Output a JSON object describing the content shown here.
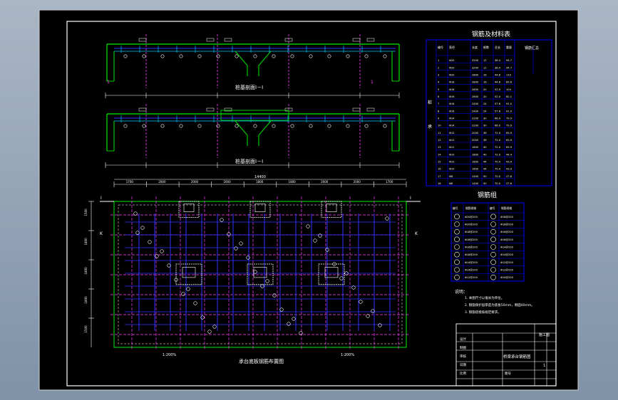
{
  "colors": {
    "background": "#000000",
    "frame": "#ffffff",
    "beam": "#00c800",
    "rebar": "#3030ff",
    "rebar_light": "#00c8ff",
    "axis": "#ff40ff",
    "dim": "#ffffff",
    "pile": "#ffffff",
    "table_line": "#0000ff",
    "note_text": "#ffffff"
  },
  "section1": {
    "title": "桩基剖面I－I",
    "label_left": "1",
    "label_right": "1"
  },
  "section2": {
    "title": "桩基剖面I－I"
  },
  "plan": {
    "title": "承台底板钢筋布置图",
    "scale_left": "1:200%",
    "scale_right": "1:200%",
    "total_dim": "14400",
    "segment_dims": [
      "1700",
      "2000",
      "2000",
      "2000",
      "1800",
      "1800",
      "2000",
      "2000",
      "1700"
    ],
    "section_mark_left": "I",
    "section_mark_right": "I",
    "side_mark_left": "K",
    "side_mark_right": "K",
    "side_dims": [
      "1500",
      "1800",
      "1800",
      "1800",
      "1500"
    ]
  },
  "rebar_table": {
    "title": "钢筋及材料表",
    "headers": [
      "编号",
      "直径",
      "长度",
      "根数",
      "总长",
      "重量"
    ],
    "group_labels": [
      "桩",
      "承"
    ],
    "extra_title": "钢筋汇总",
    "rows": [
      [
        "1",
        "Φ20",
        "3200",
        "12",
        "38.4",
        "94.7"
      ],
      [
        "2",
        "Φ20",
        "3200",
        "12",
        "38.4",
        "94.7"
      ],
      [
        "3",
        "Φ20",
        "2800",
        "16",
        "44.8",
        "110"
      ],
      [
        "4",
        "Φ18",
        "2800",
        "16",
        "44.8",
        "89.6"
      ],
      [
        "5",
        "Φ18",
        "2600",
        "20",
        "52.0",
        "104"
      ],
      [
        "6",
        "Φ16",
        "2600",
        "20",
        "52.0",
        "82.1"
      ],
      [
        "7",
        "Φ16",
        "2400",
        "24",
        "57.6",
        "91.0"
      ],
      [
        "8",
        "Φ16",
        "2400",
        "24",
        "57.6",
        "91.0"
      ],
      [
        "9",
        "Φ14",
        "2200",
        "30",
        "66.0",
        "79.9"
      ],
      [
        "10",
        "Φ14",
        "2200",
        "30",
        "66.0",
        "79.9"
      ],
      [
        "11",
        "Φ12",
        "2000",
        "36",
        "72.0",
        "63.9"
      ],
      [
        "12",
        "Φ12",
        "2000",
        "36",
        "72.0",
        "63.9"
      ],
      [
        "13",
        "Φ12",
        "1800",
        "40",
        "72.0",
        "63.9"
      ],
      [
        "14",
        "Φ10",
        "1800",
        "40",
        "72.0",
        "44.4"
      ],
      [
        "15",
        "Φ10",
        "1600",
        "44",
        "70.4",
        "43.4"
      ],
      [
        "16",
        "Φ10",
        "1600",
        "44",
        "70.4",
        "43.4"
      ],
      [
        "17",
        "Φ8",
        "1400",
        "50",
        "70.0",
        "27.6"
      ],
      [
        "18",
        "Φ8",
        "1400",
        "50",
        "70.0",
        "27.6"
      ]
    ]
  },
  "legend_table": {
    "title": "钢筋组",
    "headers": [
      "编号",
      "钢筋规格",
      "编号",
      "钢筋规格"
    ],
    "rows": [
      [
        "Φ20@200",
        "Φ18@200"
      ],
      [
        "Φ20@200",
        "Φ18@200"
      ],
      [
        "Φ18@200",
        "Φ16@200"
      ],
      [
        "Φ18@200",
        "Φ16@200"
      ],
      [
        "Φ16@200",
        "Φ14@200"
      ],
      [
        "Φ16@200",
        "Φ14@200"
      ],
      [
        "Φ14@200",
        "Φ12@200"
      ],
      [
        "Φ14@200",
        "Φ12@200"
      ],
      [
        "Φ12@200",
        "Φ10@200"
      ]
    ]
  },
  "notes": {
    "title": "说明：",
    "lines": [
      "1. 本图尺寸以毫米为单位。",
      "2. 钢筋保护层厚度为底板50mm，侧面40mm。",
      "3. 钢筋搭接按规范要求。"
    ]
  },
  "title_block": {
    "drawing_name": "桥梁承台钢筋图",
    "cells": [
      "设计",
      "制图",
      "审核",
      "日期",
      "比例",
      "图号",
      "施工图"
    ],
    "sheet": "1"
  }
}
